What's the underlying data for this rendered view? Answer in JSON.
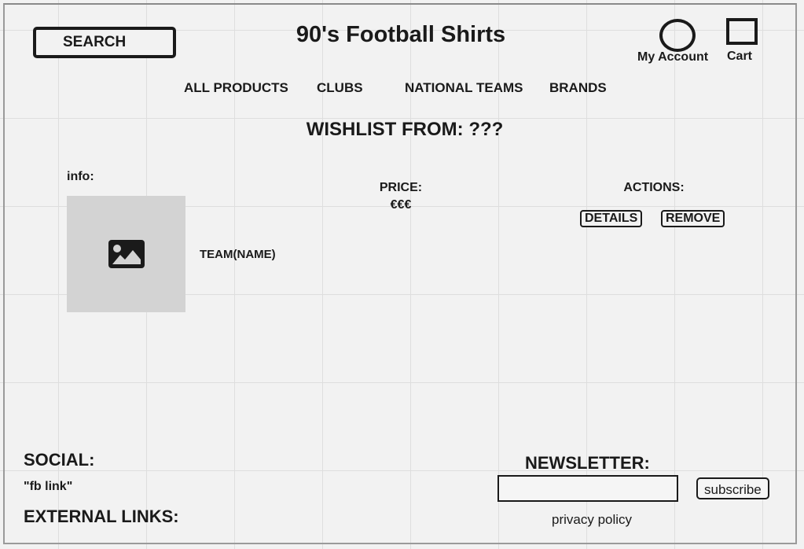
{
  "header": {
    "search_label": "SEARCH",
    "title": "90's Football Shirts",
    "account_label": "My Account",
    "cart_label": "Cart"
  },
  "nav": {
    "items": [
      {
        "label": "ALL PRODUCTS"
      },
      {
        "label": "CLUBS"
      },
      {
        "label": "NATIONAL TEAMS"
      },
      {
        "label": "BRANDS"
      }
    ]
  },
  "wishlist": {
    "heading": "WISHLIST FROM: ???",
    "info_label": "info:",
    "price_label": "PRICE:",
    "price_value": "€€€",
    "actions_label": "ACTIONS:",
    "details_label": "DETAILS",
    "remove_label": "REMOVE",
    "team_name": "TEAM(NAME)"
  },
  "footer": {
    "social_heading": "SOCIAL:",
    "fb_link": "\"fb link\"",
    "external_heading": "EXTERNAL LINKS:",
    "newsletter_heading": "NEWSLETTER:",
    "newsletter_value": "",
    "subscribe_label": "subscribe",
    "privacy_label": "privacy policy"
  }
}
